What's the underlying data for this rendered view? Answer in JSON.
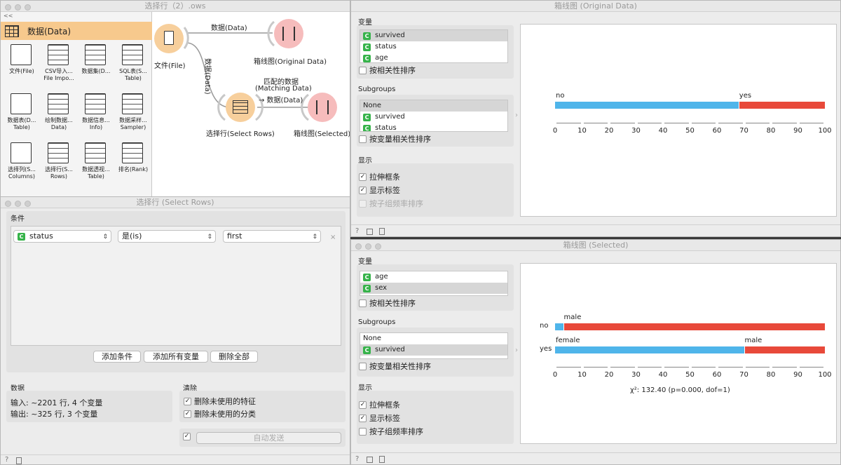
{
  "canvas": {
    "title": "选择行（2）.ows",
    "nodes": {
      "file": "文件(File)",
      "box_orig": "箱线图(Original Data)",
      "select": "选择行(Select Rows)",
      "box_sel": "箱线图(Selected)"
    },
    "links": {
      "data1": "数据(Data)",
      "data2": "数据(Data)",
      "match1": "匹配的数据",
      "match2": "(Matching Data)",
      "match3": "→ 数据(Data)"
    }
  },
  "toolbox": {
    "header": "数据(Data)",
    "collapse": "<<",
    "items": [
      {
        "icon": "file-icon",
        "l1": "文件(File)",
        "l2": ""
      },
      {
        "icon": "csv-icon",
        "l1": "CSV导入...",
        "l2": "File Impo..."
      },
      {
        "icon": "dataset-icon",
        "l1": "数据集(D...",
        "l2": ""
      },
      {
        "icon": "sql-table-icon",
        "l1": "SQL表(S...",
        "l2": "Table)"
      },
      {
        "icon": "data-table-icon",
        "l1": "数据表(D...",
        "l2": "Table)"
      },
      {
        "icon": "paint-data-icon",
        "l1": "绘制数据...",
        "l2": "Data)"
      },
      {
        "icon": "data-info-icon",
        "l1": "数据信息...",
        "l2": "Info)"
      },
      {
        "icon": "sampler-icon",
        "l1": "数据采样...",
        "l2": "Sampler)"
      },
      {
        "icon": "select-columns-icon",
        "l1": "选择列(S...",
        "l2": "Columns)"
      },
      {
        "icon": "select-rows-icon",
        "l1": "选择行(S...",
        "l2": "Rows)"
      },
      {
        "icon": "pivot-icon",
        "l1": "数据透视...",
        "l2": "Table)"
      },
      {
        "icon": "rank-icon",
        "l1": "排名(Rank)",
        "l2": ""
      }
    ]
  },
  "select_rows": {
    "title": "选择行 (Select Rows)",
    "conditions_label": "条件",
    "condition": {
      "variable": "status",
      "badge": "C",
      "operator": "是(is)",
      "value": "first",
      "remove": "×"
    },
    "buttons": {
      "add_condition": "添加条件",
      "add_all": "添加所有变量",
      "remove_all": "删除全部"
    },
    "data_label": "数据",
    "input": "输入: ~2201 行, 4 个变量",
    "output": "输出: ~325 行, 3 个变量",
    "purge_label": "清除",
    "purge_features": "删除未使用的特征",
    "purge_classes": "删除未使用的分类",
    "auto_send": "自动发送"
  },
  "box_orig": {
    "title": "箱线图 (Original Data)",
    "variables_label": "变量",
    "variables": [
      "survived",
      "status",
      "age"
    ],
    "order_by_relevance": "按相关性排序",
    "subgroups_label": "Subgroups",
    "subgroups": [
      "None",
      "survived",
      "status"
    ],
    "order_subgroup": "按变量相关性排序",
    "display_label": "显示",
    "stretch": "拉伸框条",
    "show_labels": "显示标签",
    "sort_freq": "按子组频率排序"
  },
  "box_sel": {
    "title": "箱线图 (Selected)",
    "variables_label": "变量",
    "variables": [
      "age",
      "sex"
    ],
    "order_by_relevance": "按相关性排序",
    "subgroups_label": "Subgroups",
    "subgroups": [
      "None",
      "survived"
    ],
    "order_subgroup": "按变量相关性排序",
    "display_label": "显示",
    "stretch": "拉伸框条",
    "show_labels": "显示标签",
    "sort_freq": "按子组频率排序",
    "stat": "χ²: 132.40 (p=0.000, dof=1)"
  },
  "colors": {
    "blue": "#4fb5ea",
    "red": "#e8493a",
    "node_orange": "#f7cf9c",
    "node_pink": "#f6bcbc"
  },
  "chart_data": [
    {
      "type": "bar",
      "stacked": true,
      "orientation": "horizontal",
      "categories": [
        ""
      ],
      "series": [
        {
          "name": "no",
          "values": [
            68
          ]
        },
        {
          "name": "yes",
          "values": [
            32
          ]
        }
      ],
      "ticks": [
        0,
        10,
        20,
        30,
        40,
        50,
        60,
        70,
        80,
        90,
        100
      ],
      "xlim": [
        0,
        100
      ]
    },
    {
      "type": "bar",
      "stacked": true,
      "orientation": "horizontal",
      "categories": [
        "no",
        "yes"
      ],
      "series": [
        {
          "name": "female",
          "values": [
            3,
            70
          ]
        },
        {
          "name": "male",
          "values": [
            97,
            30
          ]
        }
      ],
      "labels": [
        [
          "",
          "male"
        ],
        [
          "female",
          "male"
        ]
      ],
      "ticks": [
        0,
        10,
        20,
        30,
        40,
        50,
        60,
        70,
        80,
        90,
        100
      ],
      "xlim": [
        0,
        100
      ]
    }
  ]
}
